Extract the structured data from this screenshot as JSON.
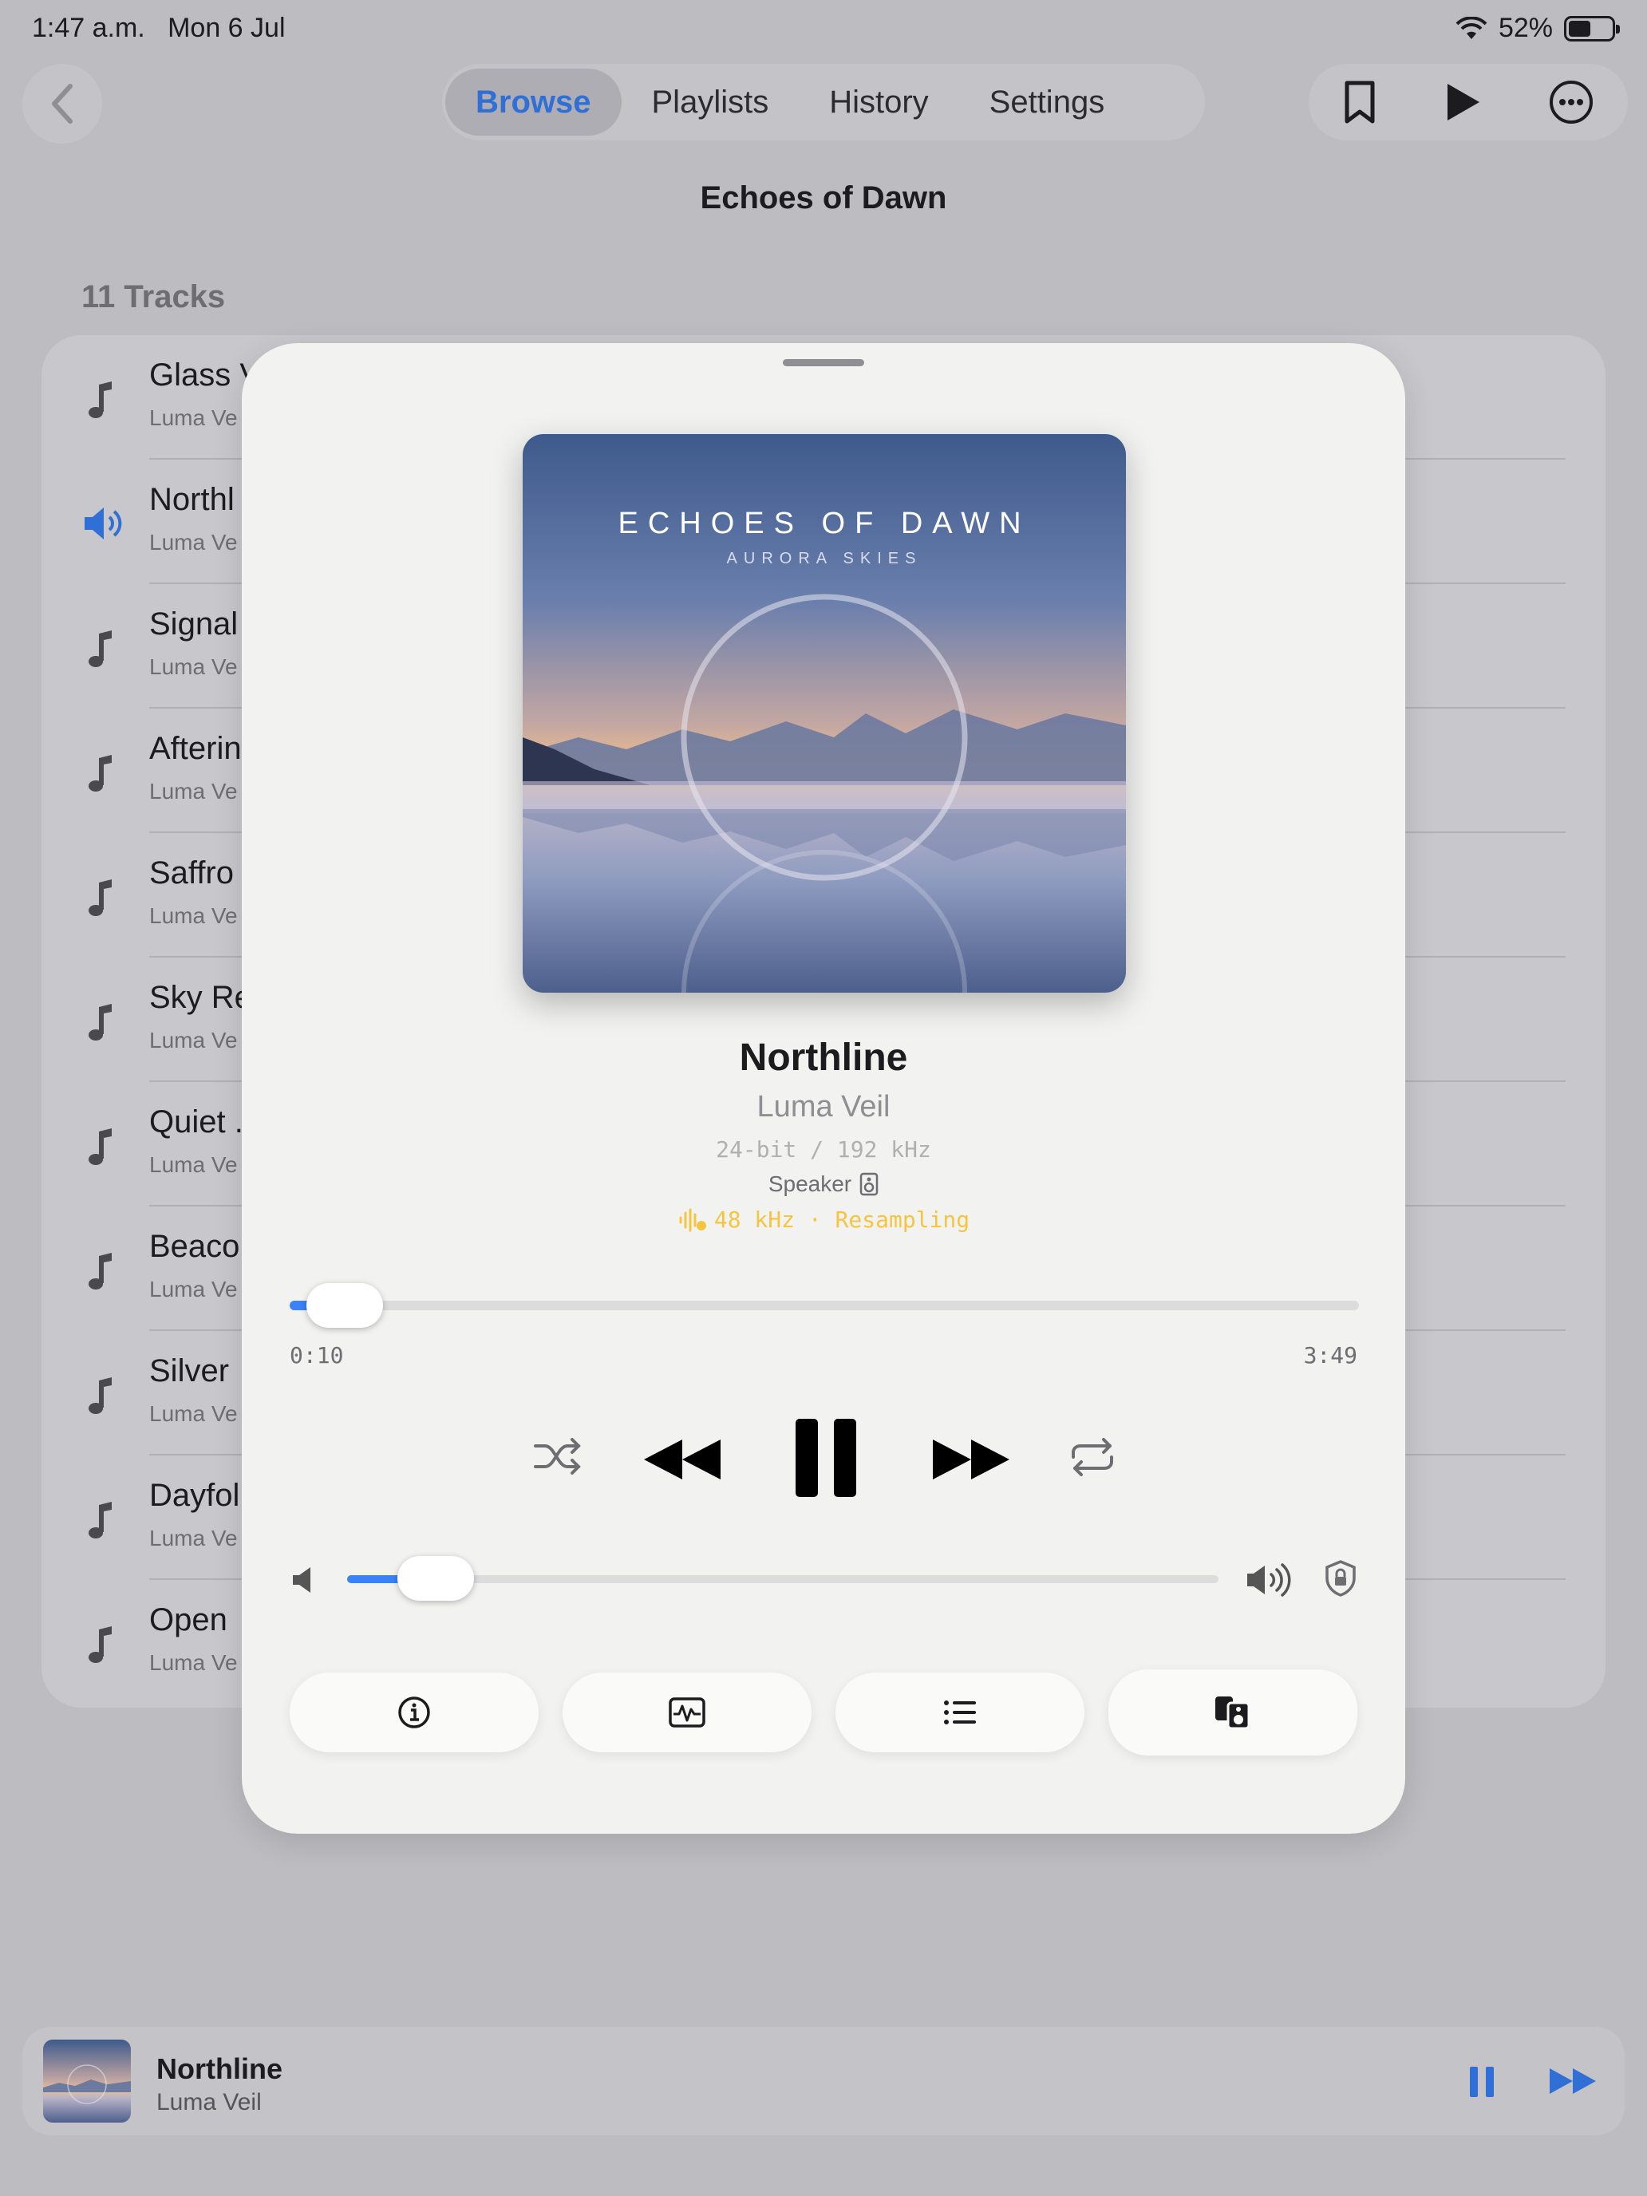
{
  "status": {
    "time": "1:47 a.m.",
    "date": "Mon 6 Jul",
    "battery": "52%"
  },
  "nav": {
    "tabs": [
      {
        "label": "Browse",
        "active": true
      },
      {
        "label": "Playlists",
        "active": false
      },
      {
        "label": "History",
        "active": false
      },
      {
        "label": "Settings",
        "active": false
      }
    ],
    "actions": [
      "bookmark-icon",
      "play-icon",
      "more-icon"
    ]
  },
  "page": {
    "title": "Echoes of Dawn",
    "tracks_count": "11 Tracks"
  },
  "tracks": [
    {
      "title": "Glass V",
      "artist": "Luma Ve",
      "playing": false
    },
    {
      "title": "Northl",
      "artist": "Luma Ve",
      "playing": true
    },
    {
      "title": "Signal",
      "artist": "Luma Ve",
      "playing": false
    },
    {
      "title": "Afterin",
      "artist": "Luma Ve",
      "playing": false
    },
    {
      "title": "Saffro",
      "artist": "Luma Ve",
      "playing": false
    },
    {
      "title": "Sky Re",
      "artist": "Luma Ve",
      "playing": false
    },
    {
      "title": "Quiet .",
      "artist": "Luma Ve",
      "playing": false
    },
    {
      "title": "Beaco",
      "artist": "Luma Ve",
      "playing": false
    },
    {
      "title": "Silver",
      "artist": "Luma Ve",
      "playing": false
    },
    {
      "title": "Dayfol",
      "artist": "Luma Ve",
      "playing": false
    },
    {
      "title": "Open",
      "artist": "Luma Ve",
      "playing": false
    }
  ],
  "now_playing": {
    "album_art": {
      "title": "ECHOES OF DAWN",
      "subtitle": "AURORA SKIES"
    },
    "title": "Northline",
    "artist": "Luma Veil",
    "format": "24-bit / 192 kHz",
    "output": "Speaker",
    "resampling": "48 kHz · Resampling",
    "elapsed": "0:10",
    "duration": "3:49",
    "progress_fraction": 0.044,
    "volume_fraction": 0.1,
    "buttons": [
      "info-icon",
      "waveform-icon",
      "queue-icon",
      "speakers-icon"
    ]
  },
  "mini_player": {
    "title": "Northline",
    "artist": "Luma Veil"
  },
  "colors": {
    "accent": "#3b82f6",
    "tab_active": "#2f6fd6",
    "resampling": "#f5c542"
  }
}
